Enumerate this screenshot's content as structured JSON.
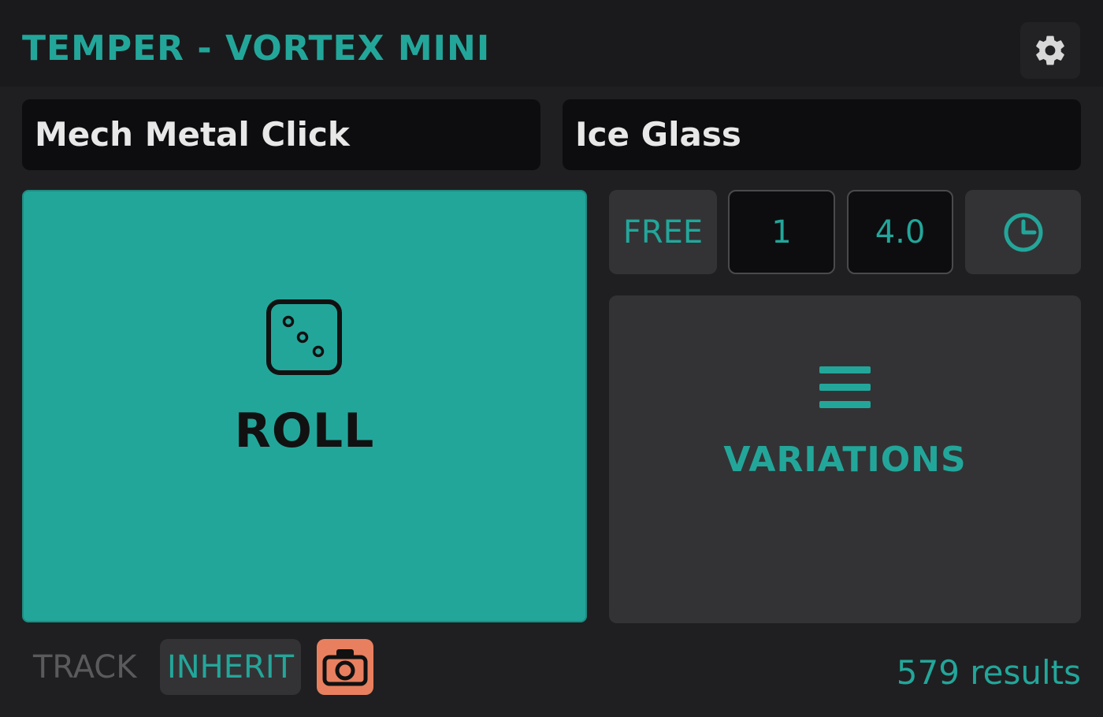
{
  "colors": {
    "accent": "#23a69a",
    "roll_bg": "#23a69a",
    "camera_bg": "#e8805f",
    "muted": "#5a5a5c"
  },
  "header": {
    "title": "TEMPER - VORTEX MINI",
    "settings_icon": "gear-icon"
  },
  "names": {
    "left": "Mech Metal Click",
    "right": "Ice Glass"
  },
  "roll": {
    "label": "ROLL",
    "icon": "dice-icon"
  },
  "controls": {
    "mode_label": "FREE",
    "value_1": "1",
    "value_2": "4.0",
    "clock_icon": "clock-icon"
  },
  "variations": {
    "label": "VARIATIONS",
    "icon": "menu-icon"
  },
  "footer": {
    "track_label": "TRACK",
    "inherit_label": "INHERIT",
    "camera_icon": "camera-icon",
    "results_text": "579 results"
  }
}
